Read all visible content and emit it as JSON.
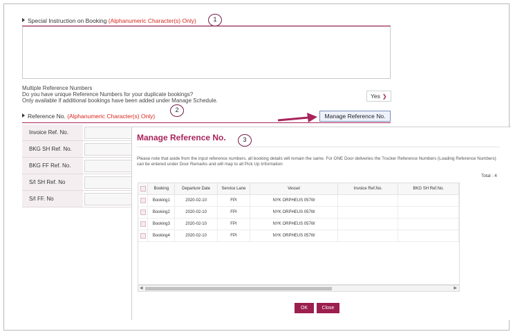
{
  "special_instruction": {
    "label": "Special Instruction on Booking",
    "note": "(Alphanumeric Character(s) Only)",
    "badge": "1"
  },
  "multiple_ref": {
    "line1": "Multiple Reference Numbers",
    "line2": "Do you have unique Reference Numbers for your duplicate bookings?",
    "line3": "Only available if additional bookings have been added under Manage Schedule.",
    "select_value": "Yes"
  },
  "reference_no": {
    "label": "Reference No.",
    "note": "(Alphanumeric Character(s) Only)",
    "badge": "2",
    "button_label": "Manage Reference No.",
    "fields": [
      {
        "label": "Invoice Ref. No."
      },
      {
        "label": "BKG SH Ref. No."
      },
      {
        "label": "BKG FF Ref. No."
      },
      {
        "label": "S/I SH Ref. No"
      },
      {
        "label": "S/I FF. No"
      }
    ]
  },
  "modal": {
    "title": "Manage Reference No.",
    "badge": "3",
    "note": "Please note that aside from the input reference numbers, all booking details will remain the same. For ONE Door deliveries the Trucker Reference Numbers (Loading Reference Numbers) can be entered under Door Remarks and will map to all Pick Up Information",
    "total": "Total : 4",
    "columns": [
      "Booking",
      "Departure Date",
      "Service Lane",
      "Vessel",
      "Invoice Ref.No.",
      "BKG SH Ref.No."
    ],
    "rows": [
      {
        "booking": "Booking1",
        "date": "2020-02-10",
        "lane": "FPI",
        "vessel": "NYK ORPHEUS 057W"
      },
      {
        "booking": "Booking2",
        "date": "2020-02-10",
        "lane": "FPI",
        "vessel": "NYK ORPHEUS 057W"
      },
      {
        "booking": "Booking3",
        "date": "2020-02-10",
        "lane": "FPI",
        "vessel": "NYK ORPHEUS 057W"
      },
      {
        "booking": "Booking4",
        "date": "2020-02-10",
        "lane": "FPI",
        "vessel": "NYK ORPHEUS 057W"
      }
    ],
    "ok_label": "OK",
    "close_label": "Close"
  },
  "colors": {
    "accent": "#a8235a",
    "button": "#9c1f4e",
    "note_red": "#d9261c"
  }
}
